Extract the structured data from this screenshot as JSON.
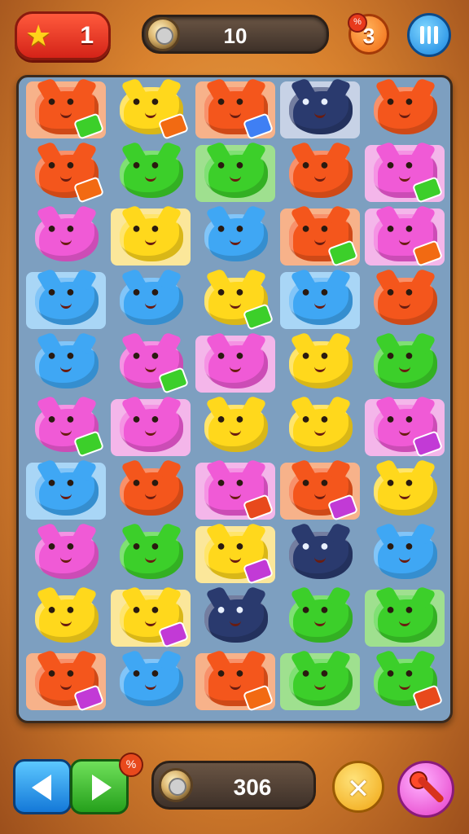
{
  "top_bar": {
    "stars": "1",
    "moves": "10",
    "hints": "3",
    "icons": [
      "star-icon",
      "coin-icon",
      "hint-icon",
      "pause-icon"
    ]
  },
  "board": {
    "columns": 5,
    "rows": 10,
    "colors": {
      "orange": "#f4561c",
      "yellow": "#ffd81c",
      "green": "#3ccf2a",
      "blue": "#3fa7f4",
      "pink": "#f05ad6",
      "navy": "#2a3a6e"
    },
    "tiles": [
      [
        "girl-orange",
        "yellow",
        "girl-orange",
        "navy",
        "orange"
      ],
      [
        "orange",
        "green",
        "green",
        "orange",
        "girl-pink"
      ],
      [
        "pink",
        "yellow",
        "blue",
        "girl-orange",
        "girl-pink"
      ],
      [
        "blue",
        "blue",
        "yellow",
        "blue",
        "orange"
      ],
      [
        "blue",
        "pink",
        "pink",
        "yellow",
        "green"
      ],
      [
        "pink",
        "pink",
        "yellow",
        "yellow",
        "pink"
      ],
      [
        "blue",
        "orange",
        "girl-pink",
        "orange",
        "yellow"
      ],
      [
        "pink",
        "green",
        "yellow",
        "navy",
        "blue"
      ],
      [
        "yellow",
        "yellow",
        "navy",
        "green",
        "green"
      ],
      [
        "orange",
        "blue",
        "girl-orange",
        "green",
        "green"
      ]
    ]
  },
  "bottom_bar": {
    "coins": "306",
    "icons": [
      "back-arrow-icon",
      "forward-arrow-icon",
      "coin-icon",
      "shuffle-icon",
      "hammer-icon"
    ]
  }
}
